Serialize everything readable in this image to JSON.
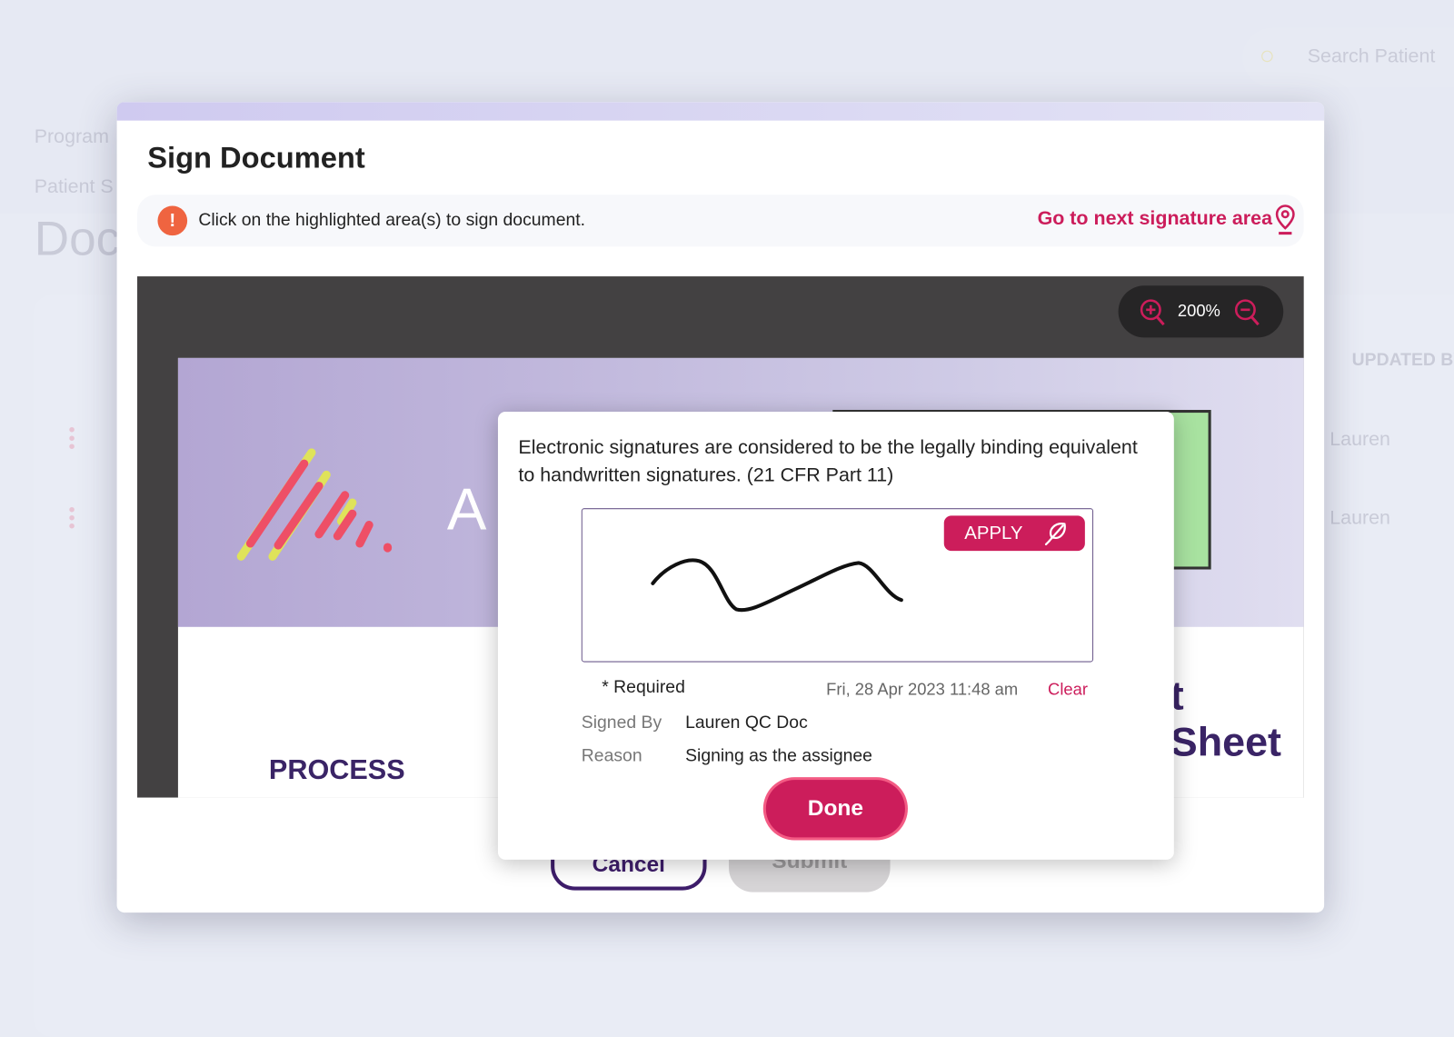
{
  "background": {
    "search_placeholder": "Search Patient",
    "breadcrumb_1": "Program",
    "breadcrumb_2": "Patient S",
    "page_title": "Doc",
    "column_header": "UPDATED BY",
    "rows": [
      {
        "updated_by": "Lauren"
      },
      {
        "updated_by": "Lauren"
      }
    ]
  },
  "modal": {
    "title": "Sign Document",
    "info_text": "Click on the highlighted area(s) to sign document.",
    "next_signature_link": "Go to next signature area",
    "zoom_level": "200%",
    "document": {
      "banner_letter": "A",
      "section_heading": "PROCESS",
      "title_fragment": "t Sheet"
    },
    "cancel_label": "Cancel",
    "submit_label": "Submit"
  },
  "signature_popup": {
    "legal_text": "Electronic signatures are considered to be the legally binding equivalent to handwritten signatures. (21 CFR Part 11)",
    "apply_label": "APPLY",
    "required_label": "* Required",
    "timestamp": "Fri, 28 Apr 2023 11:48 am",
    "clear_label": "Clear",
    "signed_by_label": "Signed By",
    "signed_by_value": "Lauren QC Doc",
    "reason_label": "Reason",
    "reason_value": "Signing as the assignee",
    "done_label": "Done"
  },
  "colors": {
    "accent": "#cc1d5b",
    "warning": "#ef6440",
    "brand_dark": "#3a2466"
  }
}
